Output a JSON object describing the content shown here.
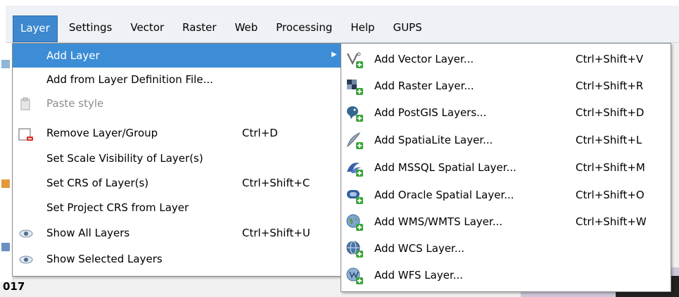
{
  "colors": {
    "menu_highlight": "#3c8dd6",
    "menubar_bg": "#eef1f5",
    "disabled_text": "#8d8d8d",
    "add_badge": "#3aa53a"
  },
  "menubar": {
    "items": [
      "Layer",
      "Settings",
      "Vector",
      "Raster",
      "Web",
      "Processing",
      "Help",
      "GUPS"
    ],
    "active": "Layer"
  },
  "layer_menu": {
    "items": [
      {
        "label": "Add Layer",
        "shortcut": "",
        "icon": "none",
        "submenu": true,
        "highlighted": true
      },
      {
        "label": "Add from Layer Definition File...",
        "shortcut": "",
        "icon": "none"
      },
      {
        "label": "Paste style",
        "shortcut": "",
        "icon": "clipboard-icon",
        "disabled": true
      },
      {
        "label": "Remove Layer/Group",
        "shortcut": "Ctrl+D",
        "icon": "remove-layer-icon"
      },
      {
        "label": "Set Scale Visibility of Layer(s)",
        "shortcut": "",
        "icon": "none"
      },
      {
        "label": "Set CRS of Layer(s)",
        "shortcut": "Ctrl+Shift+C",
        "icon": "none"
      },
      {
        "label": "Set Project CRS from Layer",
        "shortcut": "",
        "icon": "none"
      },
      {
        "label": "Show All Layers",
        "shortcut": "Ctrl+Shift+U",
        "icon": "eye-icon"
      },
      {
        "label": "Show Selected Layers",
        "shortcut": "",
        "icon": "eye-icon"
      }
    ]
  },
  "add_layer_submenu": {
    "items": [
      {
        "label": "Add Vector Layer...",
        "shortcut": "Ctrl+Shift+V",
        "icon": "vector-layer-icon"
      },
      {
        "label": "Add Raster Layer...",
        "shortcut": "Ctrl+Shift+R",
        "icon": "raster-layer-icon"
      },
      {
        "label": "Add PostGIS Layers...",
        "shortcut": "Ctrl+Shift+D",
        "icon": "postgis-icon"
      },
      {
        "label": "Add SpatiaLite Layer...",
        "shortcut": "Ctrl+Shift+L",
        "icon": "spatialite-icon"
      },
      {
        "label": "Add MSSQL Spatial Layer...",
        "shortcut": "Ctrl+Shift+M",
        "icon": "mssql-icon"
      },
      {
        "label": "Add Oracle Spatial Layer...",
        "shortcut": "Ctrl+Shift+O",
        "icon": "oracle-icon"
      },
      {
        "label": "Add WMS/WMTS Layer...",
        "shortcut": "Ctrl+Shift+W",
        "icon": "wms-icon"
      },
      {
        "label": "Add WCS Layer...",
        "shortcut": "",
        "icon": "wcs-icon"
      },
      {
        "label": "Add WFS Layer...",
        "shortcut": "",
        "icon": "wfs-icon"
      }
    ]
  },
  "background": {
    "bottom_text": "017"
  }
}
